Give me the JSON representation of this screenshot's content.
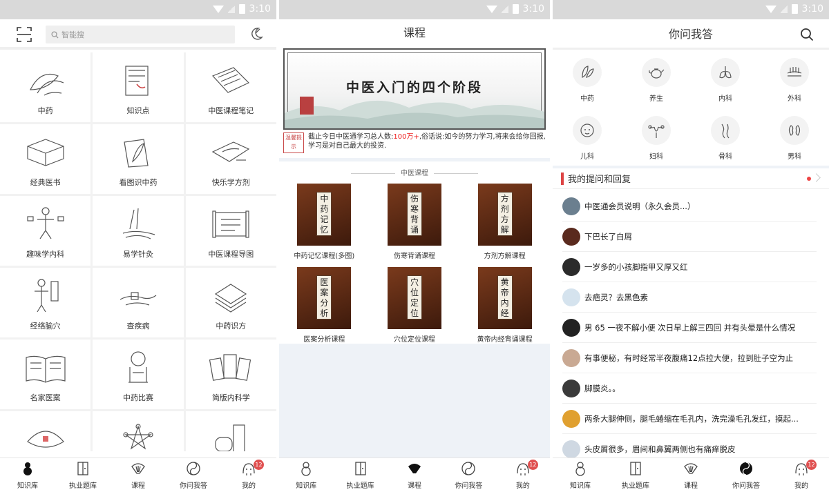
{
  "status_bar": {
    "time": "3:10"
  },
  "colors": {
    "accent_red": "#e05050",
    "bg_gray": "#f2f2f2",
    "panel_blue_bg": "#eef2f7"
  },
  "panel1": {
    "search": {
      "placeholder": "智能搜"
    },
    "grid": [
      {
        "label": "中药",
        "icon": "herb-icon"
      },
      {
        "label": "知识点",
        "icon": "scroll-icon"
      },
      {
        "label": "中医课程笔记",
        "icon": "book-scroll-icon"
      },
      {
        "label": "经典医书",
        "icon": "book-box-icon"
      },
      {
        "label": "看图识中药",
        "icon": "leaf-book-icon"
      },
      {
        "label": "快乐学方剂",
        "icon": "prescription-icon"
      },
      {
        "label": "趣味学内科",
        "icon": "body-chart-icon"
      },
      {
        "label": "易学针灸",
        "icon": "acupuncture-icon"
      },
      {
        "label": "中医课程导图",
        "icon": "map-scroll-icon"
      },
      {
        "label": "经络腧穴",
        "icon": "meridian-icon"
      },
      {
        "label": "查疾病",
        "icon": "pulse-hand-icon"
      },
      {
        "label": "中药识方",
        "icon": "stack-leaves-icon"
      },
      {
        "label": "名家医案",
        "icon": "open-book-icon"
      },
      {
        "label": "中药比赛",
        "icon": "mirror-icon"
      },
      {
        "label": "简版内科学",
        "icon": "cards-icon"
      },
      {
        "label": "",
        "icon": "umbrella-icon"
      },
      {
        "label": "",
        "icon": "five-elements-icon"
      },
      {
        "label": "",
        "icon": "bottle-icon"
      }
    ],
    "nav": [
      {
        "label": "知识库",
        "icon": "knowledge-icon"
      },
      {
        "label": "执业题库",
        "icon": "question-bank-icon"
      },
      {
        "label": "课程",
        "icon": "fan-icon"
      },
      {
        "label": "你问我答",
        "icon": "taiji-icon"
      },
      {
        "label": "我的",
        "icon": "profile-icon",
        "badge": "12"
      }
    ]
  },
  "panel2": {
    "title": "课程",
    "banner_title": "中医入门的四个阶段",
    "notice": {
      "seal_text": "温馨提示",
      "text_before": "截止今日中医通学习总人数:",
      "highlight": "100万+",
      "text_after": ",俗话说:如今的努力学习,将来会给你回报,学习是对自己最大的投资."
    },
    "section_title": "中医课程",
    "courses": [
      {
        "label": "中药记忆课程(多图)",
        "plaque": "中药记忆"
      },
      {
        "label": "伤寒背诵课程",
        "plaque": "伤寒背诵"
      },
      {
        "label": "方剂方解课程",
        "plaque": "方剂方解"
      },
      {
        "label": "医案分析课程",
        "plaque": "医案分析"
      },
      {
        "label": "穴位定位课程",
        "plaque": "穴位定位"
      },
      {
        "label": "黄帝内经背诵课程",
        "plaque": "黄帝内经"
      }
    ]
  },
  "panel3": {
    "title": "你问我答",
    "categories": [
      {
        "label": "中药",
        "icon": "leaves-icon"
      },
      {
        "label": "养生",
        "icon": "teapot-icon"
      },
      {
        "label": "内科",
        "icon": "lungs-icon"
      },
      {
        "label": "外科",
        "icon": "skin-icon"
      },
      {
        "label": "儿科",
        "icon": "baby-icon"
      },
      {
        "label": "妇科",
        "icon": "uterus-icon"
      },
      {
        "label": "骨科",
        "icon": "bone-icon"
      },
      {
        "label": "男科",
        "icon": "kidney-icon"
      }
    ],
    "my_questions": "我的提问和回复",
    "questions": [
      {
        "text": "中医通会员说明（永久会员...）",
        "avatar": "#6b7f8f"
      },
      {
        "text": "下巴长了白屑",
        "avatar": "#5a2a1e"
      },
      {
        "text": "一岁多的小孩脚指甲又厚又红",
        "avatar": "#2b2b2b"
      },
      {
        "text": "去疤灵？去黑色素",
        "avatar": "#d5e3ee"
      },
      {
        "text": "男 65 一夜不解小便 次日早上解三四回 并有头晕是什么情况",
        "avatar": "#222222"
      },
      {
        "text": "有事便秘，有时经常半夜腹痛12点拉大便，拉到肚子空为止",
        "avatar": "#c9a993"
      },
      {
        "text": "脚膜炎。。",
        "avatar": "#3a3a3a"
      },
      {
        "text": "两条大腿伸侧，腿毛蜷缩在毛孔内，洗完澡毛孔发红，摸起...",
        "avatar": "#e0a030"
      },
      {
        "text": "头皮屑很多，眉间和鼻翼两侧也有痛痒脱皮",
        "avatar": "#cfd8e2"
      }
    ]
  }
}
